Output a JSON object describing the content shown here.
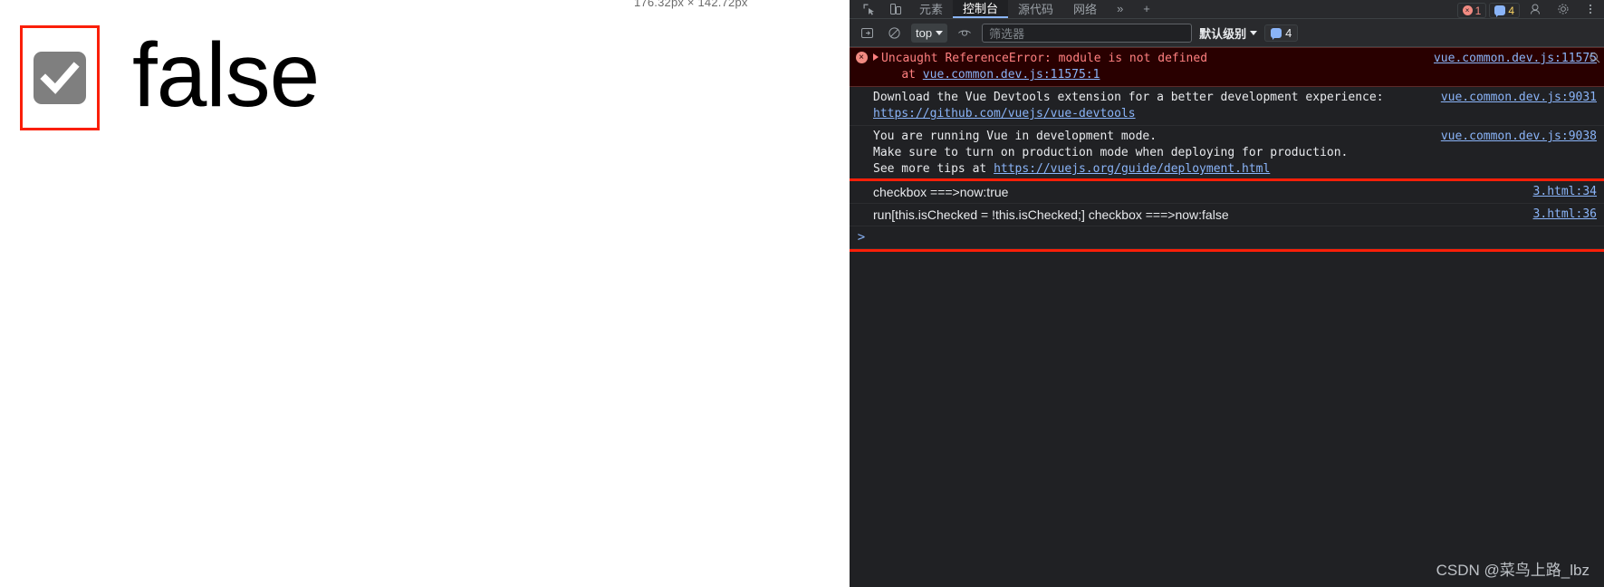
{
  "page": {
    "size_tooltip": "176.32px × 142.72px",
    "checkbox": {
      "name": "checkbox",
      "checked": true
    },
    "bool_label": "false"
  },
  "devtools": {
    "tabs": [
      {
        "label": "元素",
        "active": false
      },
      {
        "label": "控制台",
        "active": true
      },
      {
        "label": "源代码",
        "active": false
      },
      {
        "label": "网络",
        "active": false
      }
    ],
    "overflow_label": "»",
    "add_tab_label": "+",
    "error_count": "1",
    "warning_count": "4",
    "toolbar": {
      "context": "top",
      "filter_placeholder": "筛选器",
      "filter_value": "",
      "level": "默认级别",
      "badge_count": "4"
    },
    "messages": [
      {
        "type": "error",
        "expandable": true,
        "text": "Uncaught ReferenceError: module is not defined",
        "sub_prefix": "    at ",
        "sub_link": "vue.common.dev.js:11575:1",
        "source": "vue.common.dev.js:11575"
      },
      {
        "type": "info",
        "text": "Download the Vue Devtools extension for a better development experience:",
        "link": "https://github.com/vuejs/vue-devtools",
        "source": "vue.common.dev.js:9031"
      },
      {
        "type": "info",
        "line1": "You are running Vue in development mode.",
        "line2": "Make sure to turn on production mode when deploying for production.",
        "line3_prefix": "See more tips at ",
        "line3_link": "https://vuejs.org/guide/deployment.html",
        "source": "vue.common.dev.js:9038"
      },
      {
        "type": "log",
        "text": "checkbox ===>now:true",
        "source": "3.html:34"
      },
      {
        "type": "log",
        "text": "run[this.isChecked = !this.isChecked;] checkbox ===>now:false",
        "source": "3.html:36"
      }
    ],
    "prompt": ">",
    "watermark": "CSDN @菜鸟上路_lbz"
  },
  "colors": {
    "annotation_red": "#fa1f08",
    "panel_bg": "#202124",
    "error_bg": "#290000",
    "link_blue": "#8ab4f8"
  }
}
